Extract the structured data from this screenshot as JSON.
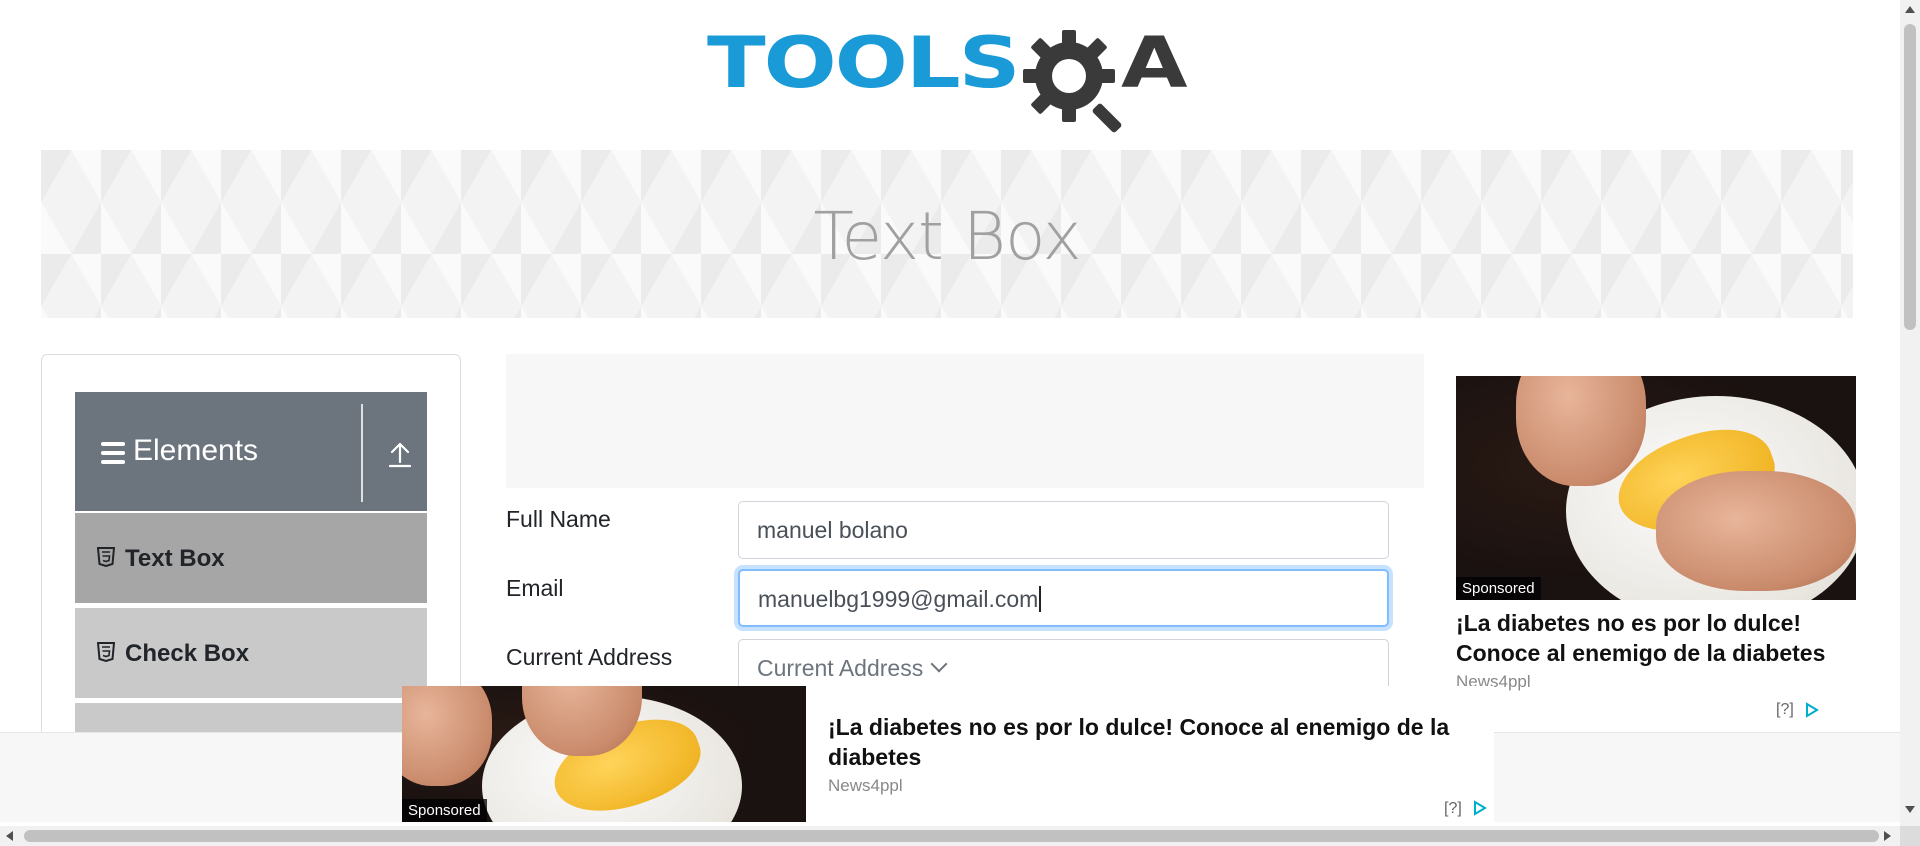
{
  "header": {
    "logo_text": "TOOLS",
    "logo_suffix": "A"
  },
  "banner": {
    "title": "Text Box"
  },
  "sidebar": {
    "group_title": "Elements",
    "items": [
      {
        "label": "Text Box",
        "icon": "html5-icon"
      },
      {
        "label": "Check Box",
        "icon": "html5-icon"
      }
    ]
  },
  "form": {
    "full_name": {
      "label": "Full Name",
      "value": "manuel bolano"
    },
    "email": {
      "label": "Email",
      "value": "manuelbg1999@gmail.com"
    },
    "current_address": {
      "label": "Current Address",
      "placeholder": "Current Address"
    }
  },
  "right_ad": {
    "sponsored": "Sponsored",
    "title": "¡La diabetes no es por lo dulce! Conoce al enemigo de la diabetes",
    "source": "News4ppl",
    "info": "[?]"
  },
  "bottom_ad": {
    "sponsored": "Sponsored",
    "title": "¡La diabetes no es por lo dulce! Conoce al enemigo de la diabetes",
    "source": "News4ppl",
    "info": "[?]"
  },
  "colors": {
    "logo_blue": "#1a9bd7",
    "logo_dark": "#3a3a3a",
    "sidebar_header": "#6c757d",
    "active_item": "#a6a6a6",
    "item_bg": "#c9c9c9",
    "focus_border": "#80bdff"
  }
}
